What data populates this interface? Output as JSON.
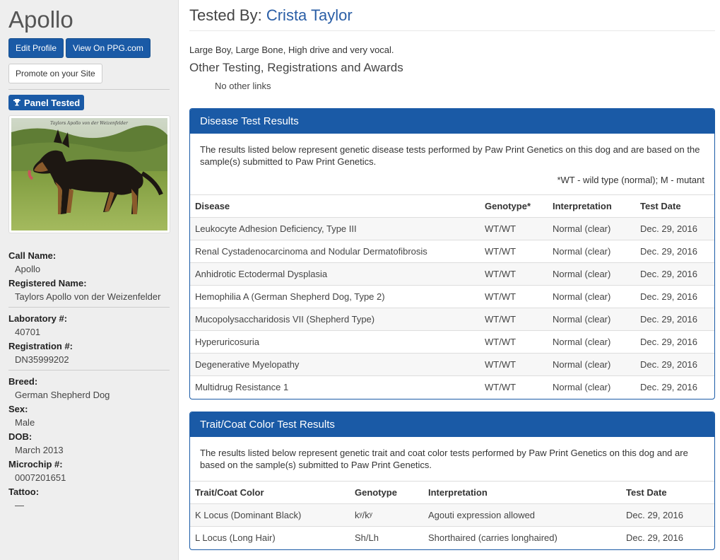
{
  "sidebar": {
    "dog_name": "Apollo",
    "buttons": {
      "edit_profile": "Edit Profile",
      "view_ppg": "View On PPG.com",
      "promote": "Promote on your Site"
    },
    "badge": "Panel Tested",
    "photo_caption": "Taylors Apollo von der Weizenfelder",
    "info": {
      "call_name_label": "Call Name:",
      "call_name": "Apollo",
      "registered_name_label": "Registered Name:",
      "registered_name": "Taylors Apollo von der Weizenfelder",
      "laboratory_label": "Laboratory #:",
      "laboratory": "40701",
      "registration_label": "Registration #:",
      "registration": "DN35999202",
      "breed_label": "Breed:",
      "breed": "German Shepherd Dog",
      "sex_label": "Sex:",
      "sex": "Male",
      "dob_label": "DOB:",
      "dob": "March 2013",
      "microchip_label": "Microchip #:",
      "microchip": "0007201651",
      "tattoo_label": "Tattoo:",
      "tattoo": "—"
    }
  },
  "main": {
    "tested_by_label": "Tested By:",
    "tested_by_name": "Crista Taylor",
    "description": "Large Boy, Large Bone, High drive and very vocal.",
    "other_heading": "Other Testing, Registrations and Awards",
    "other_value": "No other links"
  },
  "disease": {
    "title": "Disease Test Results",
    "intro": "The results listed below represent genetic disease tests performed by Paw Print Genetics on this dog and are based on the sample(s) submitted to Paw Print Genetics.",
    "legend": "*WT - wild type (normal); M - mutant",
    "headers": [
      "Disease",
      "Genotype*",
      "Interpretation",
      "Test Date"
    ],
    "rows": [
      [
        "Leukocyte Adhesion Deficiency, Type III",
        "WT/WT",
        "Normal (clear)",
        "Dec. 29, 2016"
      ],
      [
        "Renal Cystadenocarcinoma and Nodular Dermatofibrosis",
        "WT/WT",
        "Normal (clear)",
        "Dec. 29, 2016"
      ],
      [
        "Anhidrotic Ectodermal Dysplasia",
        "WT/WT",
        "Normal (clear)",
        "Dec. 29, 2016"
      ],
      [
        "Hemophilia A (German Shepherd Dog, Type 2)",
        "WT/WT",
        "Normal (clear)",
        "Dec. 29, 2016"
      ],
      [
        "Mucopolysaccharidosis VII (Shepherd Type)",
        "WT/WT",
        "Normal (clear)",
        "Dec. 29, 2016"
      ],
      [
        "Hyperuricosuria",
        "WT/WT",
        "Normal (clear)",
        "Dec. 29, 2016"
      ],
      [
        "Degenerative Myelopathy",
        "WT/WT",
        "Normal (clear)",
        "Dec. 29, 2016"
      ],
      [
        "Multidrug Resistance 1",
        "WT/WT",
        "Normal (clear)",
        "Dec. 29, 2016"
      ]
    ]
  },
  "trait": {
    "title": "Trait/Coat Color Test Results",
    "intro": "The results listed below represent genetic trait and coat color tests performed by Paw Print Genetics on this dog and are based on the sample(s) submitted to Paw Print Genetics.",
    "headers": [
      "Trait/Coat Color",
      "Genotype",
      "Interpretation",
      "Test Date"
    ],
    "rows": [
      [
        "K Locus (Dominant Black)",
        "kʸ/kʸ",
        "Agouti expression allowed",
        "Dec. 29, 2016"
      ],
      [
        "L Locus (Long Hair)",
        "Sh/Lh",
        "Shorthaired (carries longhaired)",
        "Dec. 29, 2016"
      ]
    ]
  }
}
